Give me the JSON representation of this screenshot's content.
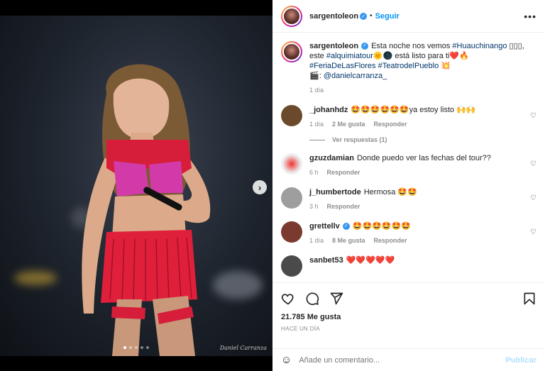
{
  "post": {
    "author": "sargentoleon",
    "follow_label": "Seguir",
    "more_label": "•••",
    "photo_signature": "Daniel Carranza",
    "carousel_count": 5,
    "carousel_active_index": 0
  },
  "caption": {
    "user": "sargentoleon",
    "text_1": "Esta noche nos vemos ",
    "hashtag_1": "#Huauchinango",
    "text_2": " ▯▯▯, este ",
    "hashtag_2": "#alquimiatour",
    "text_3": "🌞🌑 está listo para ti",
    "text_3b": "❤️🔥 ",
    "hashtag_3": "#FeriaDeLasFlores",
    "hashtag_4": "#TeatrodelPueblo",
    "text_4": " 💥",
    "text_5": "🎬: ",
    "mention": "@danielcarranza_",
    "time": "1 día"
  },
  "comments": [
    {
      "user": "_johanhdz",
      "text": "🤩🤩🤩🤩🤩🤩ya estoy listo 🙌🙌",
      "time": "1 día",
      "likes": "2 Me gusta",
      "reply": "Responder",
      "avatar_color": "#6b4a2b"
    },
    {
      "user": "gzuzdamian",
      "text": "Donde puedo ver las fechas del tour??",
      "time": "6 h",
      "likes": "",
      "reply": "Responder",
      "avatar_color": "#d9d9d9"
    },
    {
      "user": "j_humbertode",
      "text": "Hermosa 🤩🤩",
      "time": "3 h",
      "likes": "",
      "reply": "Responder",
      "avatar_color": "#9e9e9e"
    },
    {
      "user": "grettellv",
      "text": "🤩🤩🤩🤩🤩🤩",
      "time": "1 día",
      "likes": "8 Me gusta",
      "reply": "Responder",
      "avatar_color": "#7a3b2e"
    },
    {
      "user": "sanbet53",
      "text": "❤️❤️❤️❤️❤️",
      "time": "",
      "likes": "",
      "reply": "",
      "avatar_color": "#4a4a4a"
    }
  ],
  "view_replies": "Ver respuestas (1)",
  "footer": {
    "likes": "21.785 Me gusta",
    "time": "HACE UN DÍA",
    "comment_placeholder": "Añade un comentario...",
    "publish_label": "Publicar"
  },
  "icons": {
    "heart": "heart-icon",
    "comment": "comment-icon",
    "share": "share-icon",
    "save": "bookmark-icon",
    "emoji": "emoji-icon",
    "verified": "verified-badge-icon",
    "next": "chevron-right-icon"
  },
  "colors": {
    "link": "#00376b",
    "follow": "#0095f6",
    "verified": "#3897f0",
    "muted": "#8e8e8e",
    "outfit": "#e0203a"
  }
}
